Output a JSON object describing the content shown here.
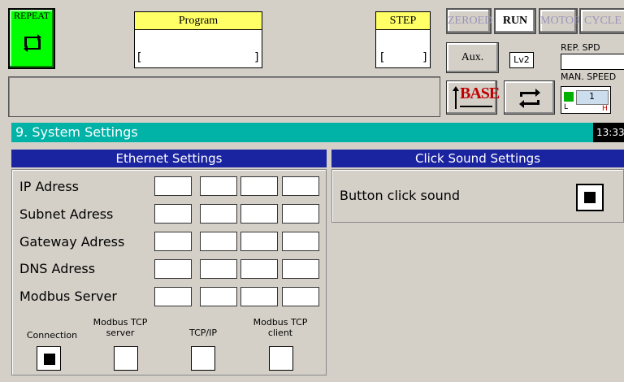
{
  "toolbar": {
    "repeat_label": "REPEAT",
    "program": {
      "header": "Program",
      "open": "[",
      "close": "]"
    },
    "step": {
      "header": "STEP",
      "open": "[",
      "close": "]"
    },
    "status_buttons": [
      "ZEROED",
      "RUN",
      "MOTOR",
      "CYCLE"
    ],
    "aux_label": "Aux.",
    "level_label": "Lv2",
    "rep_spd_label": "REP. SPD",
    "man_speed_label": "MAN. SPEED",
    "man_speed_value": "1",
    "man_speed_h": "H",
    "man_speed_l": "L",
    "base_label": "BASE"
  },
  "title": "9. System Settings",
  "clock": "13:33",
  "ethernet": {
    "header": "Ethernet Settings",
    "rows": [
      "IP Adress",
      "Subnet Adress",
      "Gateway Adress",
      "DNS Adress",
      "Modbus Server"
    ],
    "connection_label": "Connection",
    "options": [
      "Modbus TCP\nserver",
      "TCP/IP",
      "Modbus TCP\nclient"
    ]
  },
  "click_sound": {
    "header": "Click Sound Settings",
    "label": "Button click sound"
  },
  "colors": {
    "title_bar": "#00b3a6",
    "panel_header": "#1a23a0",
    "repeat": "#00ff00",
    "yellow": "#ffff66"
  }
}
